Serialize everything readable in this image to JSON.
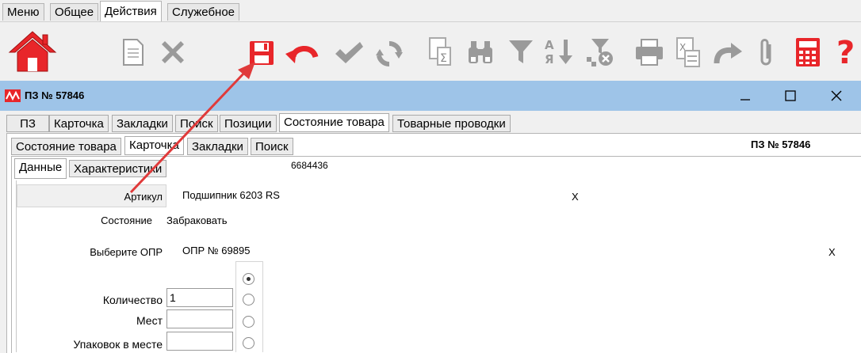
{
  "menu_tabs": [
    "Меню",
    "Общее",
    "Действия",
    "Служебное"
  ],
  "window": {
    "title": "ПЗ № 57846"
  },
  "main_tabs": [
    "ПЗ",
    "Карточка",
    "Закладки",
    "Поиск",
    "Позиции",
    "Состояние товара",
    "Товарные проводки"
  ],
  "sub_tabs": [
    "Состояние товара",
    "Карточка",
    "Закладки",
    "Поиск"
  ],
  "sub_header": "ПЗ № 57846",
  "inner_tabs": [
    "Данные",
    "Характеристики"
  ],
  "record_id": "6684436",
  "form": {
    "article_label": "Артикул",
    "article_value": "Подшипник 6203 RS",
    "article_clear": "X",
    "state_label": "Состояние",
    "state_value": "Забраковать",
    "opr_label": "Выберите ОПР",
    "opr_value": "ОПР № 69895",
    "opr_clear": "X",
    "quantity_label": "Количество",
    "quantity_value": "1",
    "places_label": "Мест",
    "places_value": "",
    "packages_label": "Упаковок в месте",
    "packages_value": ""
  },
  "colors": {
    "titlebar": "#9ec4e8",
    "accent_red": "#e8262a",
    "arrow": "#e03a3a"
  }
}
